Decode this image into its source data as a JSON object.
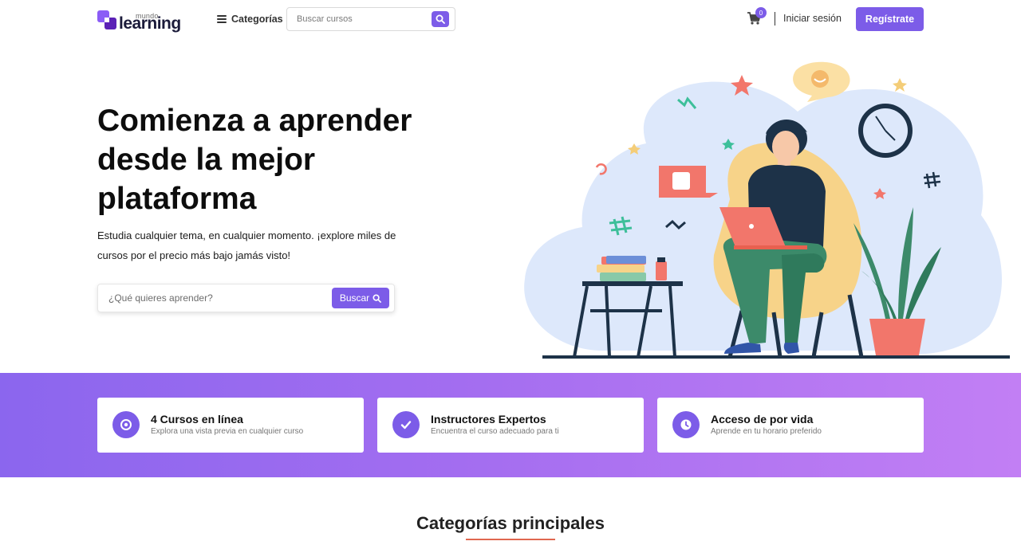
{
  "header": {
    "logo_small": "mundo",
    "logo_big": "learning",
    "categories_label": "Categorías",
    "search_placeholder": "Buscar cursos",
    "cart_count": "0",
    "login_label": "Iniciar sesión",
    "register_label": "Regístrate"
  },
  "hero": {
    "title": "Comienza a aprender desde la mejor plataforma",
    "subtitle": "Estudia cualquier tema, en cualquier momento. ¡explore miles de cursos por el precio más bajo jamás visto!",
    "search_placeholder": "¿Qué quieres aprender?",
    "search_button": "Buscar"
  },
  "features": [
    {
      "title": "4 Cursos en línea",
      "description": "Explora una vista previa en cualquier curso",
      "icon": "target-icon"
    },
    {
      "title": "Instructores Expertos",
      "description": "Encuentra el curso adecuado para ti",
      "icon": "check-icon"
    },
    {
      "title": "Acceso de por vida",
      "description": "Aprende en tu horario preferido",
      "icon": "clock-icon"
    }
  ],
  "section": {
    "title": "Categorías principales"
  },
  "colors": {
    "accent": "#7c5ce8",
    "band_start": "#8b66ee",
    "band_end": "#c27ff4",
    "underline": "#e0674f"
  }
}
